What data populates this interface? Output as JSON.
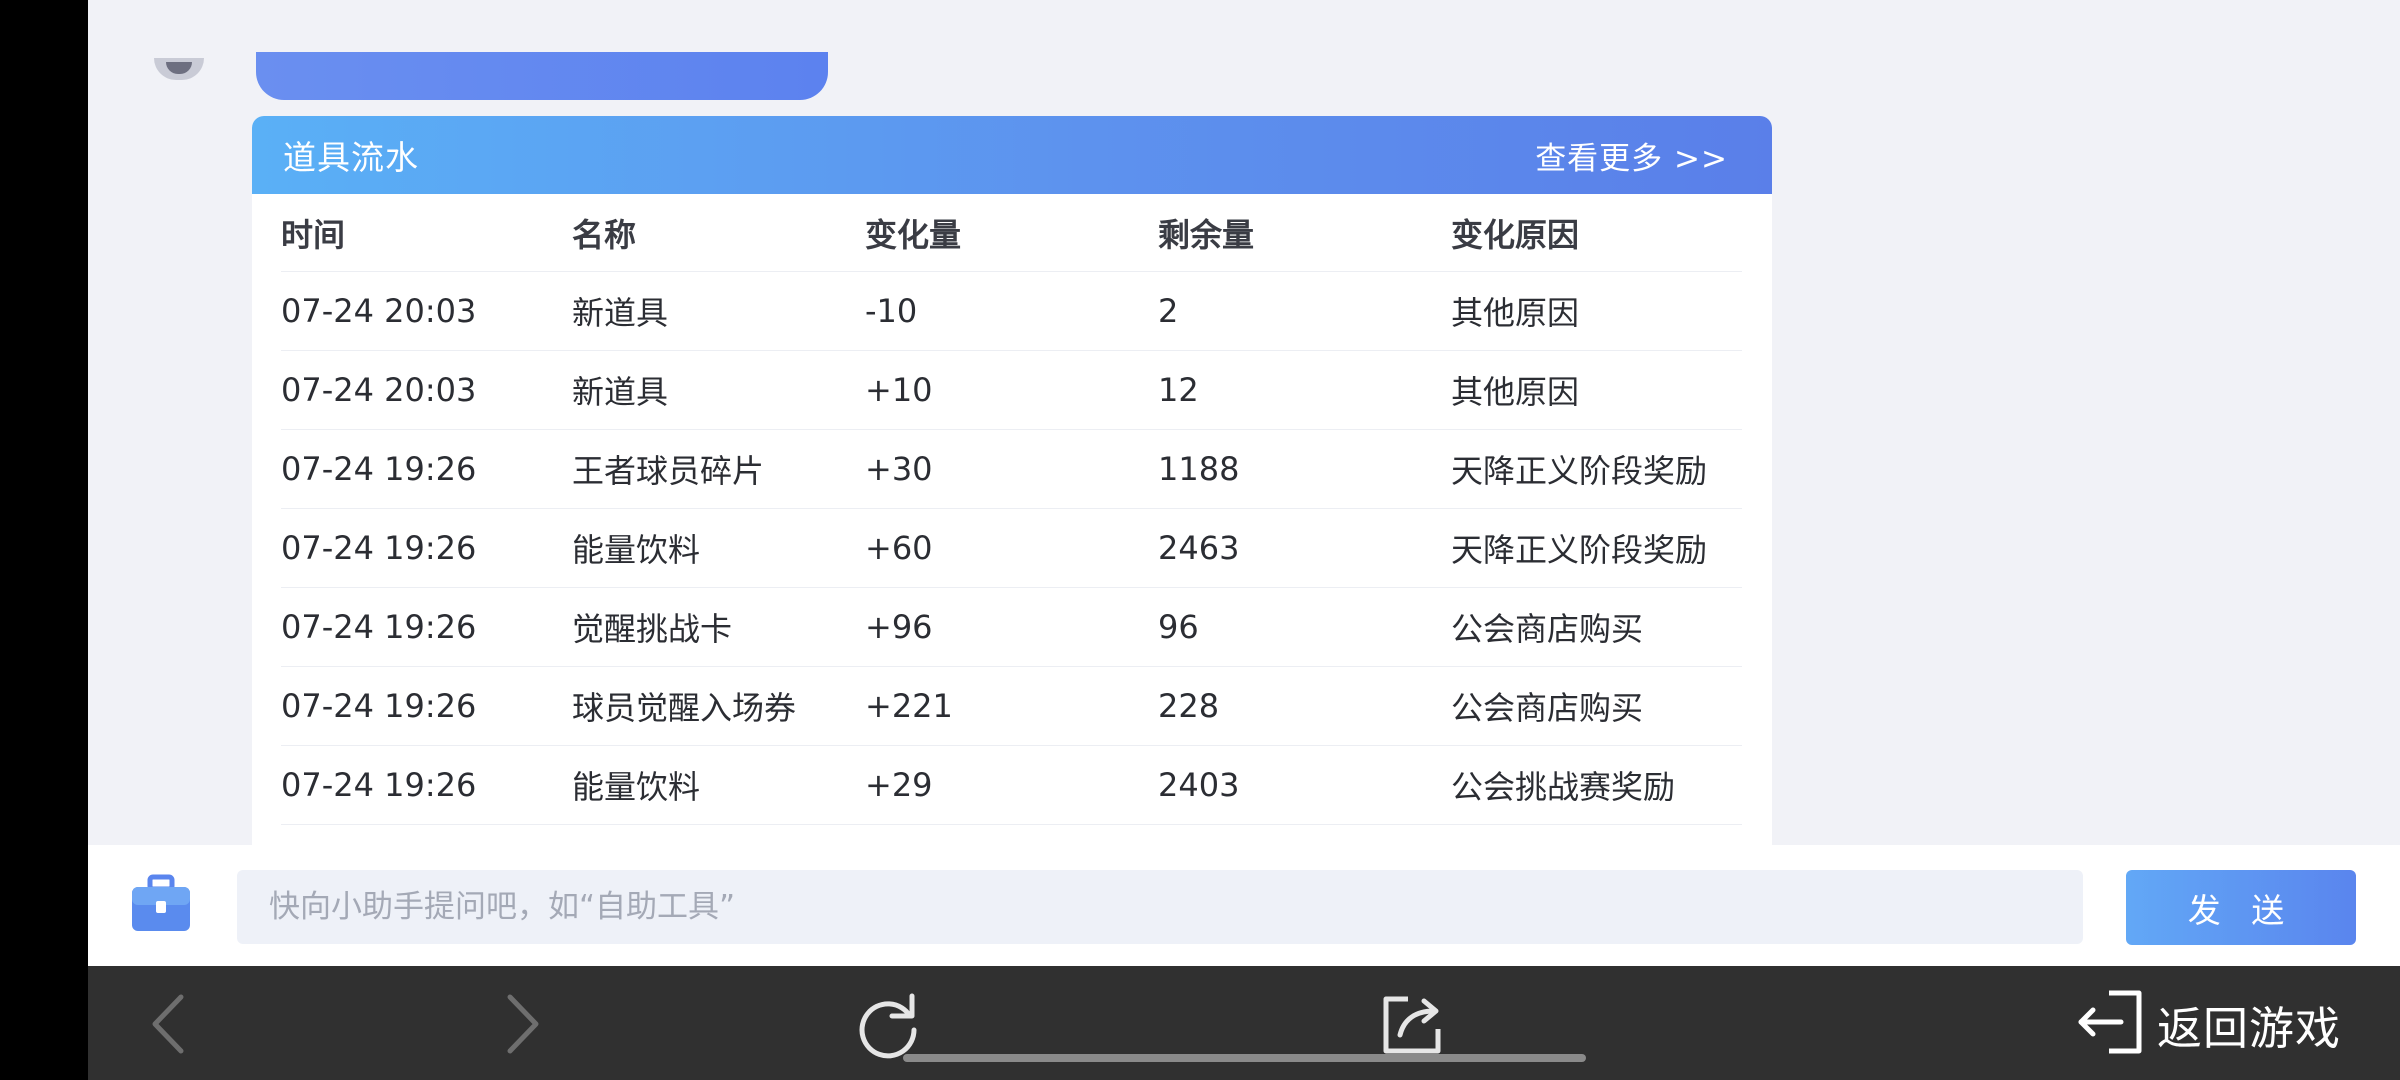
{
  "card": {
    "title": "道具流水",
    "more_link": "查看更多 >>"
  },
  "table": {
    "headers": [
      "时间",
      "名称",
      "变化量",
      "剩余量",
      "变化原因"
    ],
    "rows": [
      {
        "time": "07-24 20:03",
        "name": "新道具",
        "change": "-10",
        "remaining": "2",
        "reason": "其他原因"
      },
      {
        "time": "07-24 20:03",
        "name": "新道具",
        "change": "+10",
        "remaining": "12",
        "reason": "其他原因"
      },
      {
        "time": "07-24 19:26",
        "name": "王者球员碎片",
        "change": "+30",
        "remaining": "1188",
        "reason": "天降正义阶段奖励"
      },
      {
        "time": "07-24 19:26",
        "name": "能量饮料",
        "change": "+60",
        "remaining": "2463",
        "reason": "天降正义阶段奖励"
      },
      {
        "time": "07-24 19:26",
        "name": "觉醒挑战卡",
        "change": "+96",
        "remaining": "96",
        "reason": "公会商店购买"
      },
      {
        "time": "07-24 19:26",
        "name": "球员觉醒入场券",
        "change": "+221",
        "remaining": "228",
        "reason": "公会商店购买"
      },
      {
        "time": "07-24 19:26",
        "name": "能量饮料",
        "change": "+29",
        "remaining": "2403",
        "reason": "公会挑战赛奖励"
      }
    ]
  },
  "input_bar": {
    "placeholder": "快向小助手提问吧，如“自助工具”",
    "value": "",
    "send_label": "发 送"
  },
  "nav": {
    "return_label": "返回游戏"
  },
  "icons": {
    "toolbox": "toolbox-icon",
    "back": "chevron-left-icon",
    "forward": "chevron-right-icon",
    "refresh": "refresh-icon",
    "share": "share-icon",
    "exit": "exit-icon"
  },
  "colors": {
    "accent": "#5a85ee",
    "header_gradient_start": "#5ab0f6",
    "nav_bg": "#303030"
  }
}
